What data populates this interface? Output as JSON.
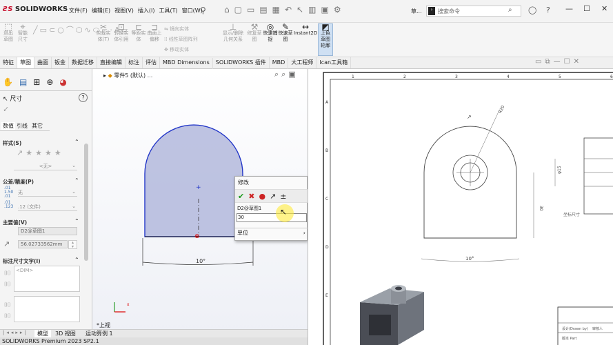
{
  "app": {
    "logo": "SOLIDWORKS"
  },
  "menu": [
    "文件(F)",
    "编辑(E)",
    "视图(V)",
    "插入(I)",
    "工具(T)",
    "窗口(W)"
  ],
  "titlebar": {
    "doc_short": "草...",
    "search_placeholder": "搜索命令"
  },
  "ribbon": {
    "left_items": [
      "退出草图",
      "智能尺寸"
    ],
    "mid_items": [
      "剪裁实体(T)",
      "转换实体引用",
      "等距实体",
      "曲面上偏移"
    ],
    "small_items": [
      "镜向实体",
      "线性草图阵列",
      "移动实体"
    ],
    "right_items": [
      "显示/删除几何关系",
      "修复草图",
      "快速捕捉",
      "快速草图",
      "Instant2D",
      "上色草图轮廓"
    ]
  },
  "tabs": [
    "特征",
    "草图",
    "曲面",
    "钣金",
    "数据迁移",
    "直接编辑",
    "标注",
    "评估",
    "MBD Dimensions",
    "SOLIDWORKS 插件",
    "MBD",
    "大工程师",
    "Ican工具箱"
  ],
  "active_tab": "草图",
  "panel": {
    "title": "尺寸",
    "subtabs": [
      "数值",
      "引线",
      "其它"
    ],
    "style_label": "样式(S)",
    "style_value": "<无>",
    "tolerance_label": "公差/精度(P)",
    "tolerance_type": "无",
    "precision_value": ".12 (文件)",
    "primary_label": "主要值(V)",
    "primary_name": "D2@草图1",
    "primary_value": "56.02733562mm",
    "text_label": "标注尺寸文字(I)",
    "text_value": "<DIM>"
  },
  "viewport": {
    "tree_item": "零件5 (默认) ...",
    "dim_text": "10°",
    "view_label": "*上视"
  },
  "modify": {
    "title": "修改",
    "name": "D2@草图1",
    "value": "30",
    "unit_label": "单位"
  },
  "drawing": {
    "col_numbers": [
      "1",
      "2",
      "3",
      "4",
      "5",
      "6"
    ],
    "row_letters": [
      "A",
      "B",
      "C",
      "D",
      "E"
    ],
    "dim_r": "R20",
    "dim_h": "30",
    "dim_phi": "φ15",
    "dim_bottom": "10°",
    "note": "坐标尺寸",
    "tb_1": "设计(Drawn by)",
    "tb_2": "审核人",
    "tb_3": "版本 Part"
  },
  "bottom": {
    "tabs": [
      "模型",
      "3D 视图",
      "运动算例 1"
    ]
  },
  "status": {
    "text": "SOLIDWORKS Premium 2023 SP2.1"
  }
}
